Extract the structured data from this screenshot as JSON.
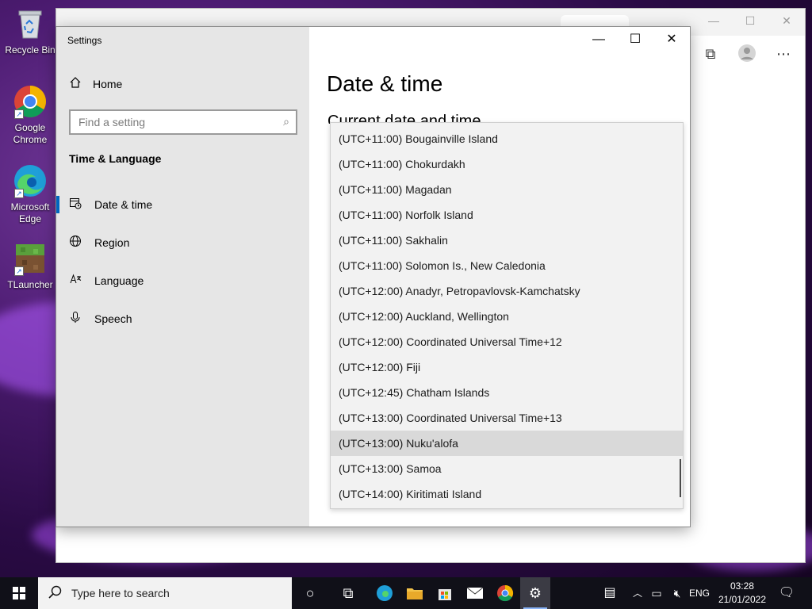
{
  "desktop": {
    "icons": [
      {
        "label": "Recycle Bin",
        "icon": "recycle-bin-icon"
      },
      {
        "label": "Google Chrome",
        "icon": "chrome-icon"
      },
      {
        "label": "Microsoft Edge",
        "icon": "edge-icon"
      },
      {
        "label": "TLauncher",
        "icon": "tlauncher-icon"
      }
    ]
  },
  "settings": {
    "window_title": "Settings",
    "home_label": "Home",
    "search_placeholder": "Find a setting",
    "section_label": "Time & Language",
    "nav": [
      {
        "label": "Date & time",
        "icon": "calendar-clock-icon",
        "selected": true
      },
      {
        "label": "Region",
        "icon": "globe-icon",
        "selected": false
      },
      {
        "label": "Language",
        "icon": "language-icon",
        "selected": false
      },
      {
        "label": "Speech",
        "icon": "microphone-icon",
        "selected": false
      }
    ],
    "page_title": "Date & time",
    "subheading": "Current date and time",
    "timezones": [
      "(UTC+11:00) Bougainville Island",
      "(UTC+11:00) Chokurdakh",
      "(UTC+11:00) Magadan",
      "(UTC+11:00) Norfolk Island",
      "(UTC+11:00) Sakhalin",
      "(UTC+11:00) Solomon Is., New Caledonia",
      "(UTC+12:00) Anadyr, Petropavlovsk-Kamchatsky",
      "(UTC+12:00) Auckland, Wellington",
      "(UTC+12:00) Coordinated Universal Time+12",
      "(UTC+12:00) Fiji",
      "(UTC+12:45) Chatham Islands",
      "(UTC+13:00) Coordinated Universal Time+13",
      "(UTC+13:00) Nuku'alofa",
      "(UTC+13:00) Samoa",
      "(UTC+14:00) Kiritimati Island"
    ],
    "hovered_timezone": "(UTC+13:00) Nuku'alofa"
  },
  "taskbar": {
    "search_placeholder": "Type here to search",
    "language": "ENG",
    "time": "03:28",
    "date": "21/01/2022"
  },
  "colors": {
    "accent": "#0067c0",
    "sidebar_bg": "#e6e6e6",
    "list_bg": "#f2f2f2",
    "hover_bg": "#d9d9d9"
  }
}
